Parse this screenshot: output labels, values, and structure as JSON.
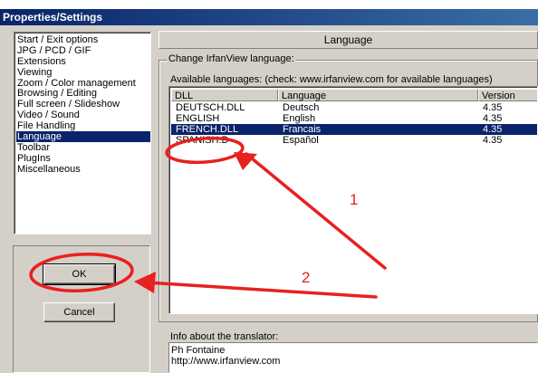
{
  "window": {
    "title": "Properties/Settings"
  },
  "sidebar": {
    "items": [
      {
        "label": "Start / Exit options"
      },
      {
        "label": "JPG / PCD / GIF"
      },
      {
        "label": "Extensions"
      },
      {
        "label": "Viewing"
      },
      {
        "label": "Zoom / Color management"
      },
      {
        "label": "Browsing / Editing"
      },
      {
        "label": "Full screen / Slideshow"
      },
      {
        "label": "Video / Sound"
      },
      {
        "label": "File Handling"
      },
      {
        "label": "Language",
        "selected": true
      },
      {
        "label": "Toolbar"
      },
      {
        "label": "PlugIns"
      },
      {
        "label": "Miscellaneous"
      }
    ]
  },
  "buttons": {
    "ok": "OK",
    "cancel": "Cancel"
  },
  "panel": {
    "header": "Language",
    "group_title": "Change IrfanView language:",
    "available_label": "Available languages: (check: www.irfanview.com for available languages)",
    "columns": [
      "DLL",
      "Language",
      "Version"
    ],
    "rows": [
      {
        "dll": "DEUTSCH.DLL",
        "language": "Deutsch",
        "version": "4.35"
      },
      {
        "dll": "ENGLISH",
        "language": "English",
        "version": "4.35"
      },
      {
        "dll": "FRENCH.DLL",
        "language": "Francais",
        "version": "4.35",
        "selected": true
      },
      {
        "dll": "SPANISH.D",
        "language": "Español",
        "version": "4.35"
      }
    ],
    "info_label": "Info about the translator:",
    "info_lines": [
      "Ph Fontaine",
      "http://www.irfanview.com"
    ]
  },
  "annotations": {
    "step1": "1",
    "step2": "2",
    "color": "#e8201e"
  }
}
